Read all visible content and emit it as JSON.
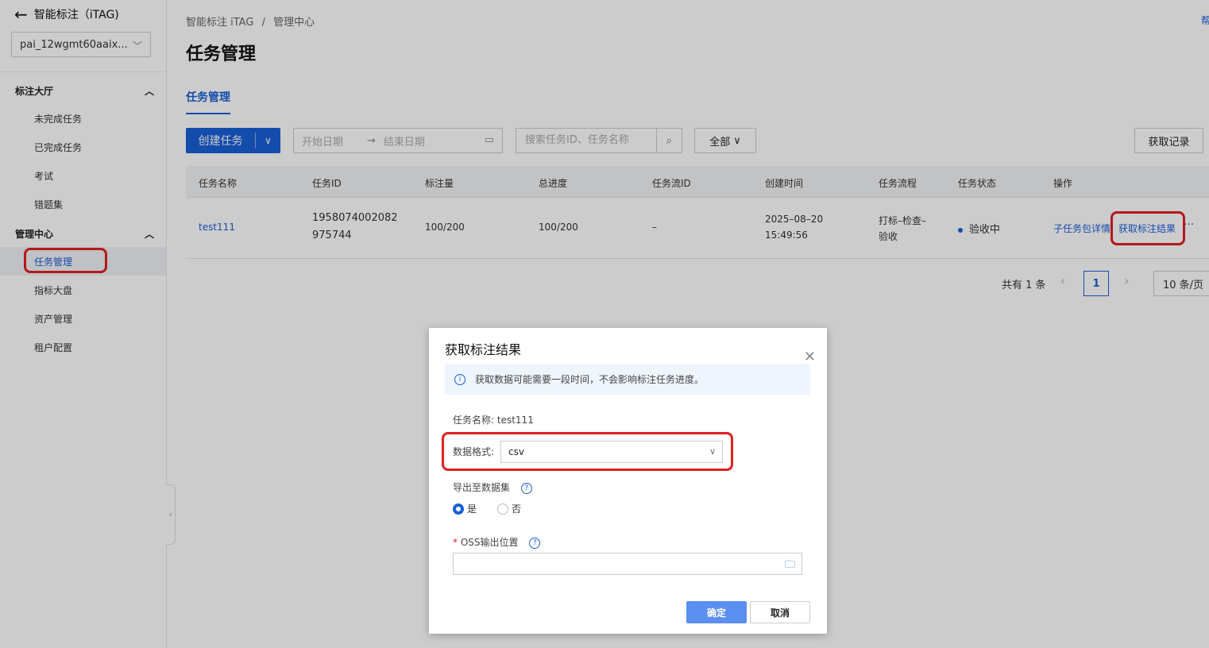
{
  "sidebar": {
    "app_title": "智能标注（iTAG)",
    "workspace": "pai_12wgmt60aaix...",
    "groups": [
      {
        "label": "标注大厅",
        "items": [
          "未完成任务",
          "已完成任务",
          "考试",
          "错题集"
        ]
      },
      {
        "label": "管理中心",
        "items": [
          "任务管理",
          "指标大盘",
          "资产管理",
          "租户配置"
        ]
      }
    ]
  },
  "breadcrumb": {
    "root": "智能标注 iTAG",
    "sep": "/",
    "current": "管理中心"
  },
  "help_label": "帮",
  "page_title": "任务管理",
  "tab_label": "任务管理",
  "toolbar": {
    "create_label": "创建任务",
    "start_date_placeholder": "开始日期",
    "date_arrow": "→",
    "end_date_placeholder": "结束日期",
    "search_placeholder": "搜索任务ID、任务名称",
    "filter_label": "全部",
    "records_label": "获取记录"
  },
  "table": {
    "headers": [
      "任务名称",
      "任务ID",
      "标注量",
      "总进度",
      "任务流ID",
      "创建时间",
      "任务流程",
      "任务状态",
      "操作"
    ],
    "row": {
      "name": "test111",
      "id_line1": "1958074002082",
      "id_line2": "975744",
      "annotated": "100/200",
      "progress": "100/200",
      "flow_id": "–",
      "created_date": "2025–08–20",
      "created_time": "15:49:56",
      "process_line1": "打标–检查–",
      "process_line2": "验收",
      "status": "验收中",
      "action_detail": "子任务包详情",
      "action_fetch": "获取标注结果",
      "action_more": "···"
    }
  },
  "pager": {
    "total": "共有 1 条",
    "prev": "‹",
    "page": "1",
    "next": "›",
    "size": "10 条/页"
  },
  "modal": {
    "title": "获取标注结果",
    "close": "✕",
    "info": "获取数据可能需要一段时间，不会影响标注任务进度。",
    "task_name_label": "任务名称:",
    "task_name_value": "test111",
    "format_label": "数据格式:",
    "format_value": "csv",
    "export_label": "导出至数据集",
    "yes": "是",
    "no": "否",
    "required_mark": "*",
    "oss_label": "OSS输出位置",
    "ok": "确定",
    "cancel": "取消"
  }
}
